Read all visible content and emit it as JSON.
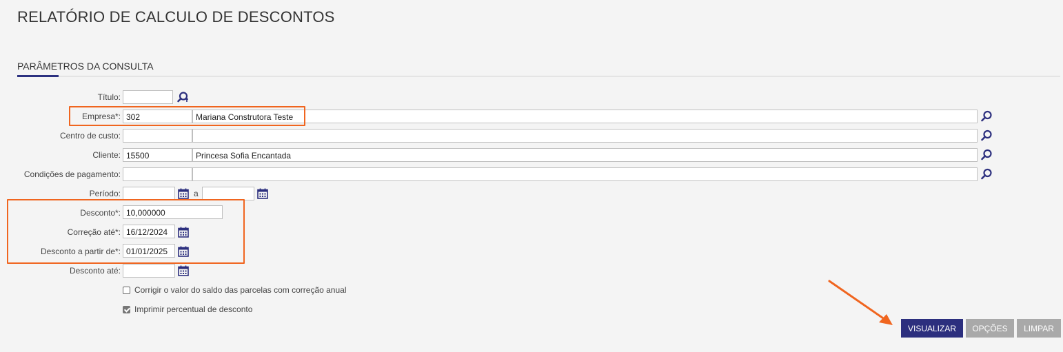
{
  "page": {
    "title": "RELATÓRIO DE CALCULO DE DESCONTOS",
    "section_title": "PARÂMETROS DA CONSULTA"
  },
  "form": {
    "titulo": {
      "label": "Título:",
      "value": ""
    },
    "empresa": {
      "label": "Empresa*:",
      "code": "302",
      "name": "Mariana Construtora Teste"
    },
    "centro_custo": {
      "label": "Centro de custo:",
      "code": "",
      "name": ""
    },
    "cliente": {
      "label": "Cliente:",
      "code": "15500",
      "name": "Princesa Sofia Encantada"
    },
    "condicoes_pagamento": {
      "label": "Condições de pagamento:",
      "code": "",
      "name": ""
    },
    "periodo": {
      "label": "Período:",
      "from": "",
      "separator": "a",
      "to": ""
    },
    "desconto": {
      "label": "Desconto*:",
      "value": "10,000000"
    },
    "correcao_ate": {
      "label": "Correção até*:",
      "value": "16/12/2024"
    },
    "desconto_a_partir": {
      "label": "Desconto a partir de*:",
      "value": "01/01/2025"
    },
    "desconto_ate": {
      "label": "Desconto até:",
      "value": ""
    },
    "corrigir_saldo": {
      "label": "Corrigir o valor do saldo das parcelas com correção anual",
      "checked": false
    },
    "imprimir_percentual": {
      "label": "Imprimir percentual de desconto",
      "checked": true
    }
  },
  "buttons": {
    "visualizar": "VISUALIZAR",
    "opcoes": "OPÇÕES",
    "limpar": "LIMPAR"
  },
  "icons": {
    "search": "search-icon",
    "calendar": "calendar-icon"
  },
  "colors": {
    "primary": "#2c2f7e",
    "highlight": "#f0651f",
    "disabled": "#a9a9a9",
    "background": "#f4f4f4"
  }
}
